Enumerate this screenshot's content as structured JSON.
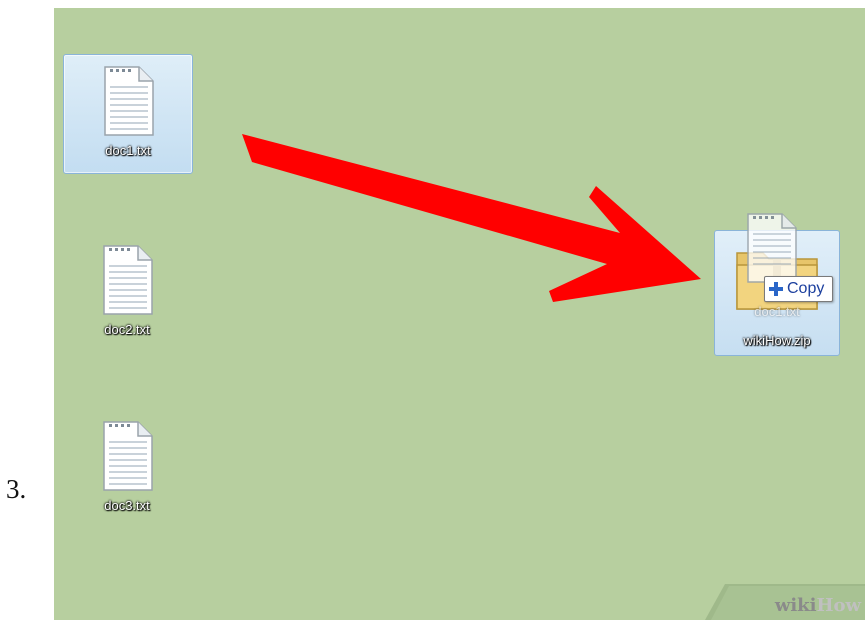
{
  "step": {
    "number": "3."
  },
  "desktop": {
    "files": [
      {
        "name": "doc1.txt",
        "icon": "text-file-icon",
        "selected": true
      },
      {
        "name": "doc2.txt",
        "icon": "text-file-icon",
        "selected": false
      },
      {
        "name": "doc3.txt",
        "icon": "text-file-icon",
        "selected": false
      }
    ],
    "zip_target": {
      "name": "wikiHow.zip",
      "ghost_label": "doc1.txt",
      "icon": "zip-folder-icon"
    },
    "drag_tooltip": {
      "label": "Copy",
      "icon": "plus-icon"
    }
  },
  "watermark": {
    "wiki": "wiki",
    "how": "How"
  },
  "colors": {
    "desktop": "#b7cf9f",
    "arrow": "#ff0000",
    "selection": "#c3ddf1"
  }
}
